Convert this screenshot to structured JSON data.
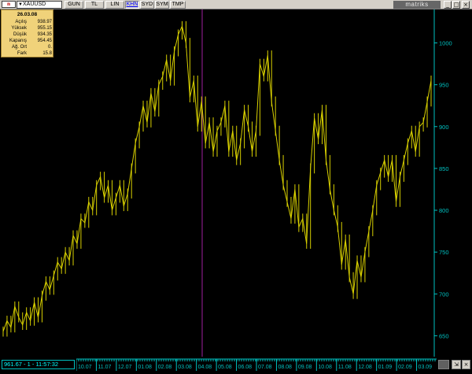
{
  "titlebar": {
    "app_icon_text": "m",
    "symbol": "XAUUSD",
    "tabs": [
      "GUN",
      "TL",
      "LIN",
      "KHN",
      "SYD",
      "SYM",
      "TMP"
    ],
    "active_tab": "KHN",
    "brand": "matriks",
    "min_label": "_",
    "max_label": "□",
    "close_label": "×"
  },
  "info": {
    "date": "26.03.08",
    "rows": [
      {
        "label": "Açılış",
        "value": "938.97"
      },
      {
        "label": "Yüksek",
        "value": "955.15"
      },
      {
        "label": "Düşük",
        "value": "934.35"
      },
      {
        "label": "Kapanış",
        "value": "954.45"
      },
      {
        "label": "Ağ. Ort",
        "value": "0."
      },
      {
        "label": "Fark",
        "value": "15.8"
      }
    ]
  },
  "status": {
    "text": "961.67 - 1 - 11:57:32"
  },
  "colors": {
    "price_line": "#d8d000",
    "axis": "#00c0c0",
    "cursor_line": "#a020a0",
    "info_bg": "#f0d27a"
  },
  "chart_data": {
    "type": "line",
    "y_ticks": [
      650,
      700,
      750,
      800,
      850,
      900,
      950,
      1000
    ],
    "ylim": [
      625,
      1040
    ],
    "x_labels": [
      "10.07",
      "11.07",
      "12.07",
      "01.08",
      "02.08",
      "03.08",
      "04.08",
      "05.08",
      "06.08",
      "07.08",
      "08.08",
      "09.08",
      "10.08",
      "11.08",
      "12.08",
      "01.09",
      "02.09",
      "03.09"
    ],
    "series": [
      {
        "values": [
          655,
          668,
          660,
          685,
          672,
          663,
          678,
          668,
          690,
          672,
          698,
          715,
          705,
          722,
          738,
          730,
          750,
          740,
          770,
          760,
          790,
          785,
          810,
          800,
          830,
          840,
          815,
          830,
          800,
          815,
          830,
          805,
          820,
          850,
          880,
          900,
          925,
          905,
          940,
          918,
          950,
          960,
          980,
          955,
          990,
          1010,
          1020,
          1000,
          935,
          955,
          900,
          930,
          880,
          905,
          870,
          895,
          905,
          925,
          870,
          895,
          860,
          880,
          920,
          900,
          870,
          895,
          975,
          960,
          985,
          930,
          895,
          860,
          830,
          810,
          790,
          825,
          780,
          790,
          760,
          850,
          910,
          885,
          920,
          860,
          825,
          800,
          780,
          735,
          765,
          720,
          700,
          740,
          720,
          750,
          775,
          800,
          830,
          845,
          860,
          840,
          860,
          810,
          840,
          860,
          880,
          895,
          870,
          900,
          905,
          930,
          955
        ]
      }
    ]
  }
}
